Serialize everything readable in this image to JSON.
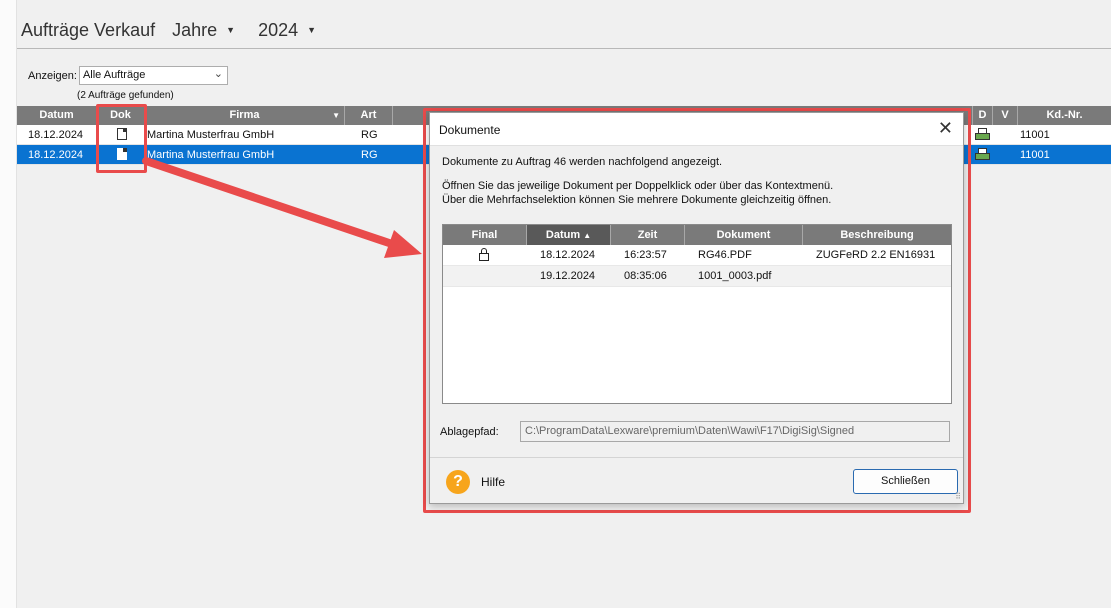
{
  "header": {
    "title": "Aufträge Verkauf",
    "period_label": "Jahre",
    "year": "2024"
  },
  "filter": {
    "label": "Anzeigen:",
    "selected": "Alle Aufträge",
    "found_text": "(2 Aufträge gefunden)"
  },
  "table": {
    "columns": {
      "datum": "Datum",
      "dok": "Dok",
      "firma": "Firma",
      "art": "Art",
      "d": "D",
      "v": "V",
      "kdnr": "Kd.-Nr."
    },
    "rows": [
      {
        "datum": "18.12.2024",
        "firma": "Martina Musterfrau GmbH",
        "art": "RG",
        "kdnr": "11001"
      },
      {
        "datum": "18.12.2024",
        "firma": "Martina Musterfrau GmbH",
        "art": "RG",
        "kdnr": "11001"
      }
    ]
  },
  "dialog": {
    "title": "Dokumente",
    "intro": "Dokumente zu Auftrag 46 werden nachfolgend angezeigt.",
    "hint1": "Öffnen Sie das jeweilige Dokument per Doppelklick oder über das Kontextmenü.",
    "hint2": "Über die Mehrfachselektion können Sie mehrere Dokumente gleichzeitig öffnen.",
    "columns": {
      "final": "Final",
      "datum": "Datum",
      "zeit": "Zeit",
      "dokument": "Dokument",
      "beschreibung": "Beschreibung"
    },
    "sort_indicator": "▲",
    "rows": [
      {
        "final": "lock-icon",
        "datum": "18.12.2024",
        "zeit": "16:23:57",
        "dokument": "RG46.PDF",
        "beschreibung": "ZUGFeRD 2.2 EN16931"
      },
      {
        "final": "",
        "datum": "19.12.2024",
        "zeit": "08:35:06",
        "dokument": "1001_0003.pdf",
        "beschreibung": ""
      }
    ],
    "path_label": "Ablagepfad:",
    "path_value": "C:\\ProgramData\\Lexware\\premium\\Daten\\Wawi\\F17\\DigiSig\\Signed",
    "help_icon_glyph": "?",
    "help_label": "Hilfe",
    "close_label": "Schließen"
  },
  "colors": {
    "annotation": "#e94b4b",
    "selection": "#0a73d1",
    "header_bg": "#7a7a7a"
  }
}
